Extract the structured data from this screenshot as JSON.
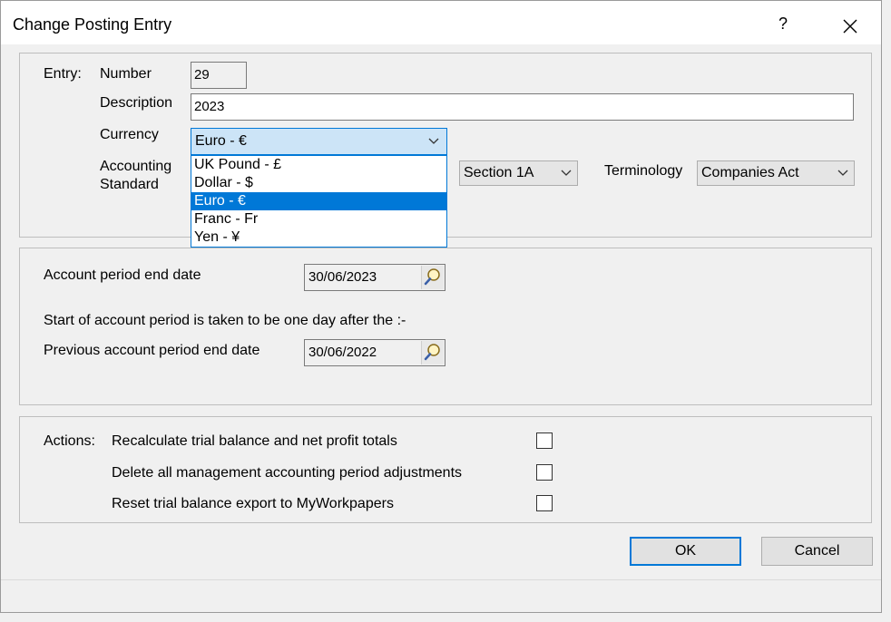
{
  "window": {
    "title": "Change Posting Entry",
    "help": "?"
  },
  "entry": {
    "group_label": "Entry:",
    "number_label": "Number",
    "number_value": "29",
    "description_label": "Description",
    "description_value": "2023",
    "currency_label": "Currency",
    "currency_value": "Euro - €",
    "currency_options": [
      "UK Pound - £",
      "Dollar - $",
      "Euro - €",
      "Franc - Fr",
      "Yen - ¥"
    ],
    "currency_selected_index": 2,
    "accounting_standard_label_1": "Accounting",
    "accounting_standard_label_2": "Standard",
    "accounting_standard_value": "Section 1A",
    "terminology_label": "Terminology",
    "terminology_value": "Companies Act"
  },
  "period": {
    "end_date_label": "Account period end date",
    "end_date_value": "30/06/2023",
    "start_note": "Start of account period is taken to be one day after the :-",
    "prev_end_date_label": "Previous account period end date",
    "prev_end_date_value": "30/06/2022"
  },
  "actions": {
    "group_label": "Actions:",
    "items": [
      {
        "label": "Recalculate trial balance and net profit totals",
        "checked": false
      },
      {
        "label": "Delete all management accounting period adjustments",
        "checked": false
      },
      {
        "label": "Reset trial balance export to MyWorkpapers",
        "checked": false
      }
    ]
  },
  "buttons": {
    "ok": "OK",
    "cancel": "Cancel"
  },
  "colors": {
    "accent": "#0078d7",
    "selection_bg": "#cce4f7",
    "background": "#f0f0f0"
  }
}
